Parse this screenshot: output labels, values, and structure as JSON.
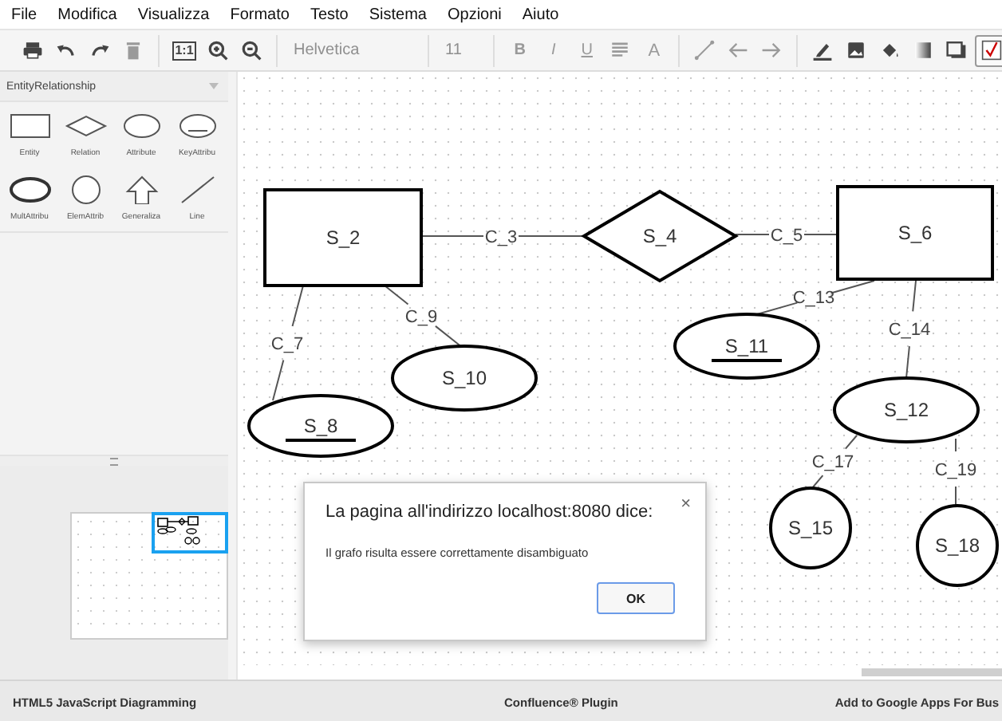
{
  "menu": [
    "File",
    "Modifica",
    "Visualizza",
    "Formato",
    "Testo",
    "Sistema",
    "Opzioni",
    "Aiuto"
  ],
  "toolbar": {
    "groups": [
      [
        {
          "kind": "print",
          "disabled": false
        },
        {
          "kind": "undo",
          "disabled": false
        },
        {
          "kind": "redo",
          "disabled": false
        },
        {
          "kind": "delete",
          "disabled": true
        }
      ],
      [
        {
          "kind": "actual_size",
          "label": "1:1",
          "disabled": false
        },
        {
          "kind": "zoom_in",
          "disabled": false
        },
        {
          "kind": "zoom_out",
          "disabled": false
        }
      ],
      [
        {
          "kind": "font",
          "label": "Helvetica",
          "disabled": true
        }
      ],
      [
        {
          "kind": "font_size",
          "label": "11",
          "disabled": true
        }
      ],
      [
        {
          "kind": "bold",
          "label": "B",
          "disabled": true
        },
        {
          "kind": "italic",
          "label": "I",
          "disabled": true
        },
        {
          "kind": "underline",
          "label": "U",
          "disabled": true
        },
        {
          "kind": "align",
          "disabled": true
        },
        {
          "kind": "font_color",
          "label": "A",
          "disabled": true
        }
      ],
      [
        {
          "kind": "line",
          "disabled": true
        },
        {
          "kind": "arrow_start",
          "disabled": true
        },
        {
          "kind": "arrow_end",
          "disabled": true
        }
      ],
      [
        {
          "kind": "stroke",
          "disabled": false
        },
        {
          "kind": "image",
          "disabled": false
        },
        {
          "kind": "fill",
          "disabled": false
        },
        {
          "kind": "gradient",
          "disabled": false
        },
        {
          "kind": "shadow",
          "disabled": false
        },
        {
          "kind": "validate",
          "disabled": false,
          "selected": true
        }
      ]
    ]
  },
  "palette": {
    "title": "EntityRelationship",
    "items": [
      {
        "kind": "entity",
        "label": "Entity"
      },
      {
        "kind": "relation",
        "label": "Relation"
      },
      {
        "kind": "attribute",
        "label": "Attribute"
      },
      {
        "kind": "key",
        "label": "KeyAttribu"
      },
      {
        "kind": "multivalued",
        "label": "MultAttribu"
      },
      {
        "kind": "elementary",
        "label": "ElemAttrib"
      },
      {
        "kind": "generalization",
        "label": "Generaliza"
      },
      {
        "kind": "line",
        "label": "Line"
      }
    ]
  },
  "diagram": {
    "nodes": [
      {
        "kind": "entity",
        "label": "S_2"
      },
      {
        "kind": "relation",
        "label": "S_4"
      },
      {
        "kind": "entity",
        "label": "S_6"
      },
      {
        "kind": "key",
        "label": "S_8"
      },
      {
        "kind": "attribute",
        "label": "S_10"
      },
      {
        "kind": "key",
        "label": "S_11"
      },
      {
        "kind": "attribute",
        "label": "S_12"
      },
      {
        "kind": "elementary",
        "label": "S_15"
      },
      {
        "kind": "elementary",
        "label": "S_18"
      }
    ],
    "edges": [
      {
        "label": "C_3"
      },
      {
        "label": "C_5"
      },
      {
        "label": "C_7"
      },
      {
        "label": "C_9"
      },
      {
        "label": "C_13"
      },
      {
        "label": "C_14"
      },
      {
        "label": "C_17"
      },
      {
        "label": "C_19"
      }
    ]
  },
  "dialog": {
    "title": "La pagina all'indirizzo localhost:8080 dice:",
    "close": "×",
    "message": "Il grafo risulta essere correttamente disambiguato",
    "button": "OK"
  },
  "footer": [
    "HTML5 JavaScript Diagramming",
    "Confluence® Plugin",
    "Add to Google Apps For Bus"
  ]
}
